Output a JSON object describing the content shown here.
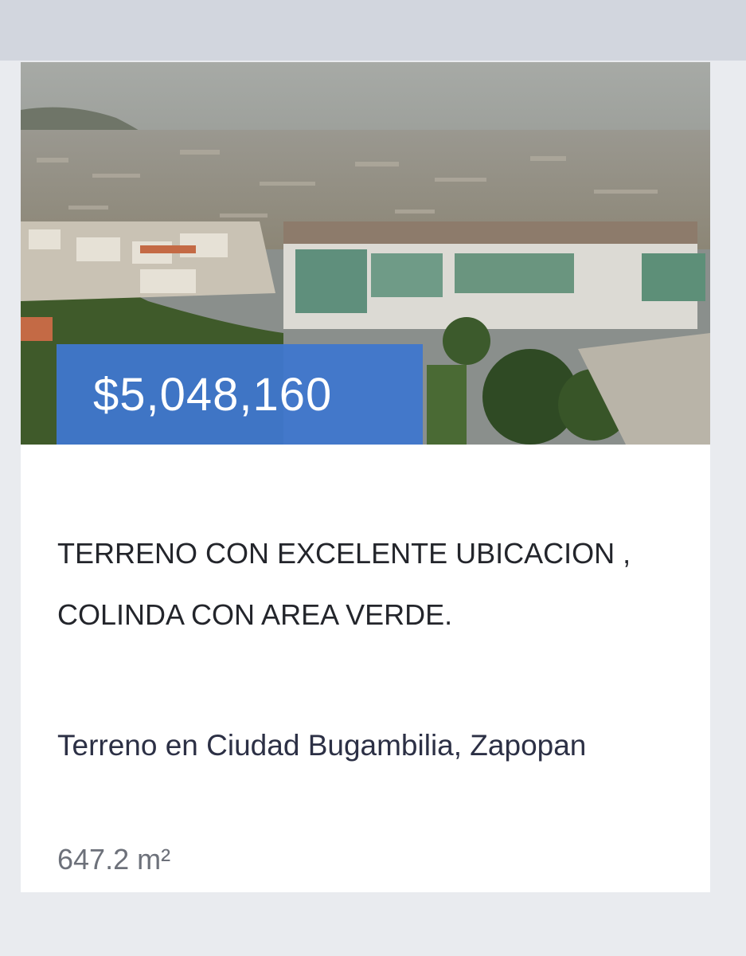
{
  "listing": {
    "price": "$5,048,160",
    "title": "TERRENO CON EXCELENTE UBICACION , COLINDA CON AREA VERDE.",
    "location": "Terreno en Ciudad Bugambilia, Zapopan",
    "area": "647.2 m²",
    "photo_icon": "aerial-city-photo",
    "colors": {
      "badge": "#3f77cd",
      "title": "#23252b",
      "location": "#2c3045",
      "area": "#6d717a",
      "page_background": "#e9ebef",
      "top_bar": "#d2d6de"
    }
  }
}
